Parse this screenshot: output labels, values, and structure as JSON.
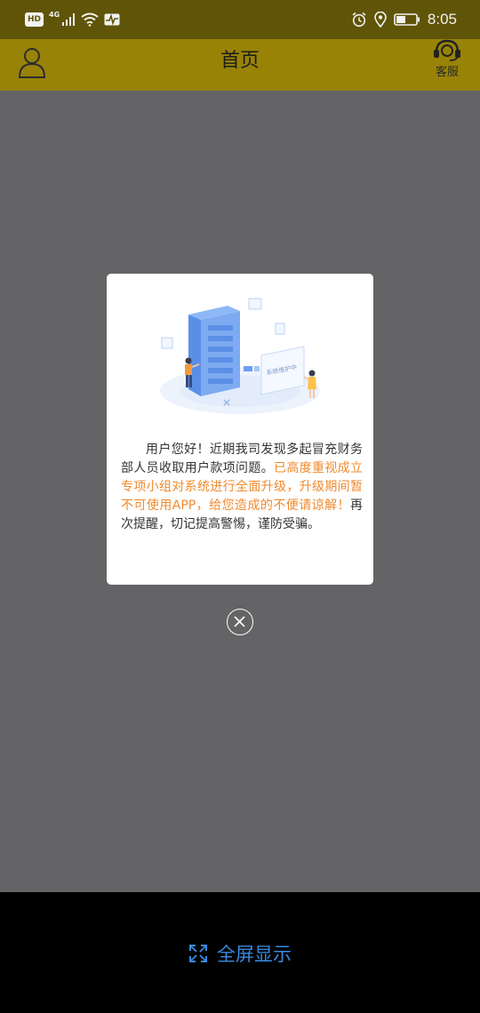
{
  "status_bar": {
    "hd": "HD",
    "network": "4G",
    "time": "8:05"
  },
  "header": {
    "title": "首页",
    "service_label": "客服"
  },
  "dialog": {
    "notice_part1": "用户您好！近期我司发现多起冒充财务部人员收取用户款项问题。",
    "notice_highlight": "已高度重视成立专项小组对系统进行全面升级，升级期间暂不可使用APP，给您造成的不便请谅解！",
    "notice_part2": "再次提醒，切记提高警惕，谨防受骗。",
    "illustration_screen_text": "系统维护中",
    "highlight_color": "#f08a2c"
  },
  "bottom_bar": {
    "fullscreen_label": "全屏显示",
    "accent_color": "#3a8ae0"
  }
}
